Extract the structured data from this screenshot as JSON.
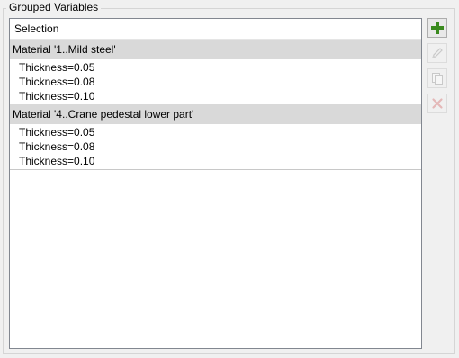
{
  "groupbox": {
    "title": "Grouped Variables"
  },
  "list": {
    "header": "Selection",
    "groups": [
      {
        "label": "Material '1..Mild steel'",
        "items": [
          "Thickness=0.05",
          "Thickness=0.08",
          "Thickness=0.10"
        ]
      },
      {
        "label": "Material '4..Crane pedestal lower part'",
        "items": [
          "Thickness=0.05",
          "Thickness=0.08",
          "Thickness=0.10"
        ]
      }
    ]
  },
  "toolbar": {
    "buttons": [
      {
        "icon": "plus-icon",
        "enabled": true,
        "color": "#3a8a1e"
      },
      {
        "icon": "pencil-icon",
        "enabled": false
      },
      {
        "icon": "copy-icon",
        "enabled": false
      },
      {
        "icon": "delete-x-icon",
        "enabled": false
      }
    ]
  },
  "colors": {
    "group_row_bg": "#d9d9d9",
    "list_border": "#828790",
    "add_green": "#3a8a1e"
  }
}
